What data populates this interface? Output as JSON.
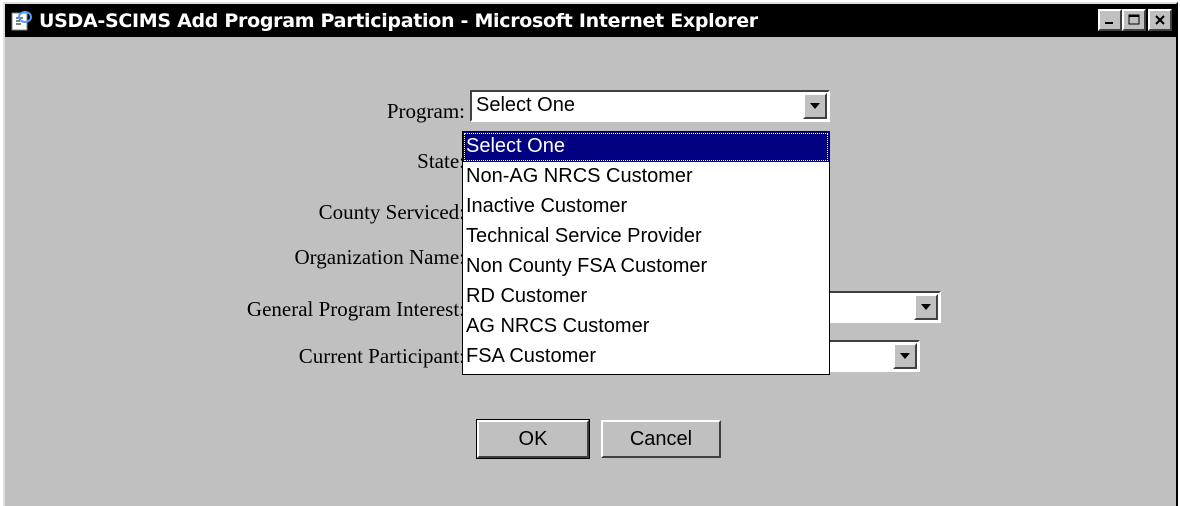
{
  "window": {
    "title": "USDA-SCIMS Add Program Participation - Microsoft Internet Explorer",
    "icon": "ie-page-icon",
    "controls": [
      "minimize-icon",
      "maximize-icon",
      "close-icon"
    ]
  },
  "form": {
    "program_label": "Program:",
    "program_value": "Select One",
    "state_label": "State:",
    "county_label": "County Serviced:",
    "organization_label": "Organization Name:",
    "interest_label": "General Program Interest:",
    "participant_label": "Current Participant:"
  },
  "program_options": [
    "Select One",
    "Non-AG NRCS Customer",
    "Inactive Customer",
    "Technical Service Provider",
    "Non County FSA Customer",
    "RD Customer",
    "AG NRCS Customer",
    "FSA Customer"
  ],
  "buttons": {
    "ok": "OK",
    "cancel": "Cancel"
  },
  "colors": {
    "titlebar": "#000000",
    "dialog_bg": "#c0c0c0",
    "highlight": "#000080"
  }
}
